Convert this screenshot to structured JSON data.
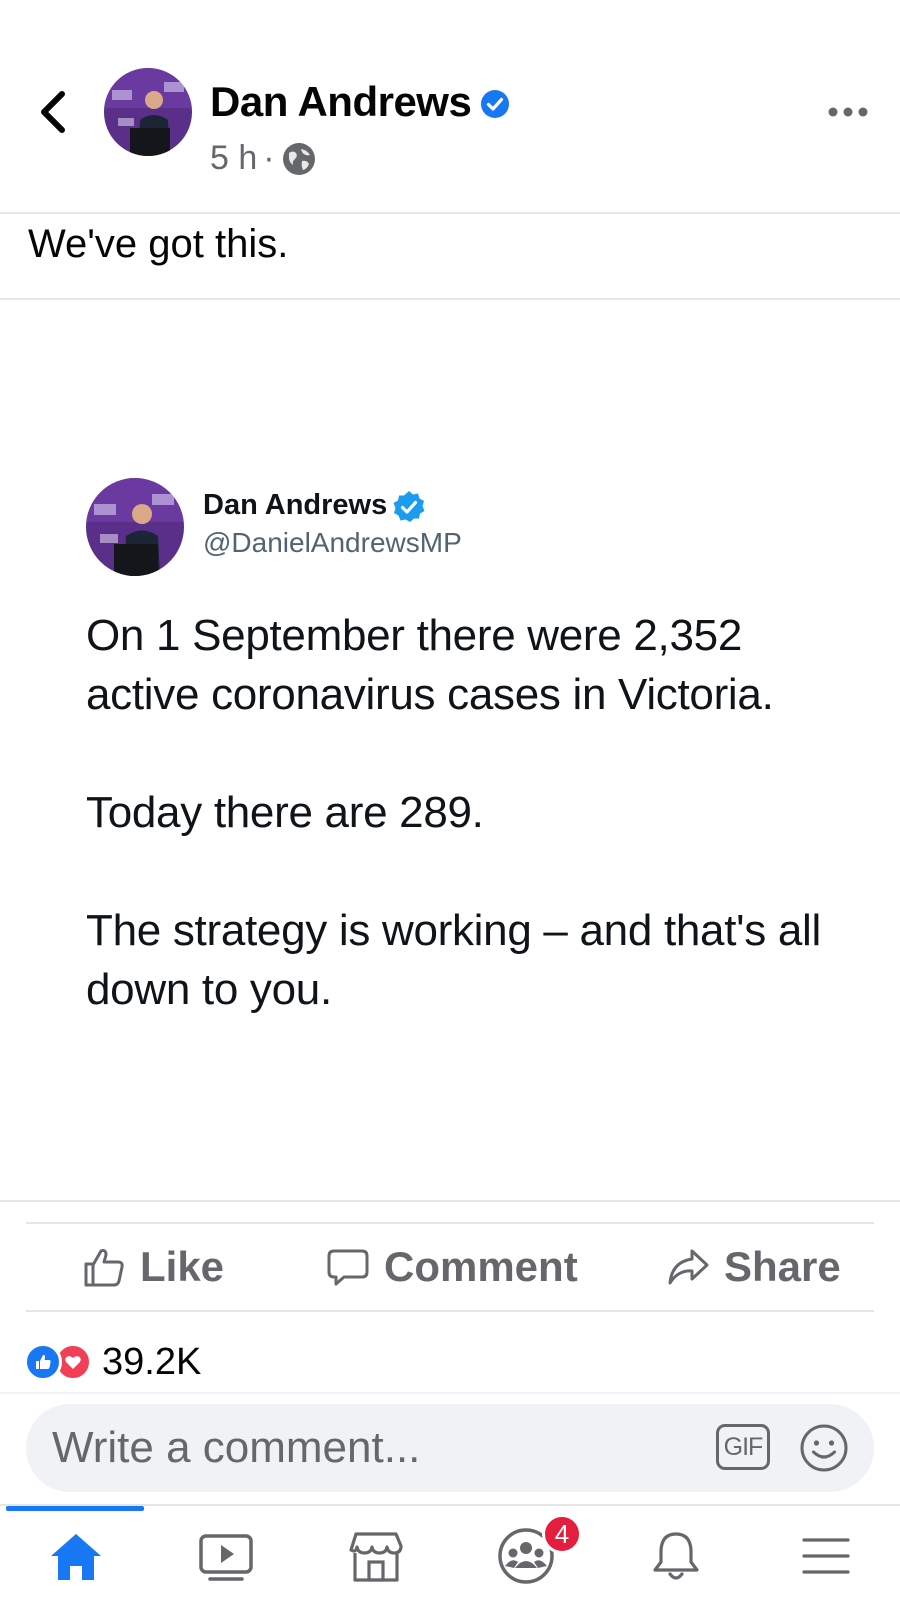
{
  "post": {
    "author": "Dan Andrews",
    "time": "5 h",
    "separator": "·",
    "text": "We've got this."
  },
  "tweet": {
    "name": "Dan Andrews",
    "handle": "@DanielAndrewsMP",
    "paragraphs": [
      "On 1 September there were 2,352 active coronavirus cases in Victoria.",
      "Today there are 289.",
      "The strategy is working – and that's all down to you."
    ]
  },
  "actions": {
    "like": "Like",
    "comment": "Comment",
    "share": "Share"
  },
  "reactions": {
    "count": "39.2K"
  },
  "comment_box": {
    "placeholder": "Write a comment...",
    "gif_label": "GIF"
  },
  "tabbar": {
    "groups_badge": "4",
    "active_tab": "home"
  },
  "icons": {
    "back": "chevron-left-icon",
    "more": "more-horizontal-icon",
    "audience": "globe-icon",
    "verified": "verified-badge-icon"
  },
  "colors": {
    "accent": "#1877f2",
    "love": "#f33e58",
    "badge": "#e41e3f",
    "secondary_text": "#65676b",
    "twitter_verified": "#1d9bf0"
  }
}
